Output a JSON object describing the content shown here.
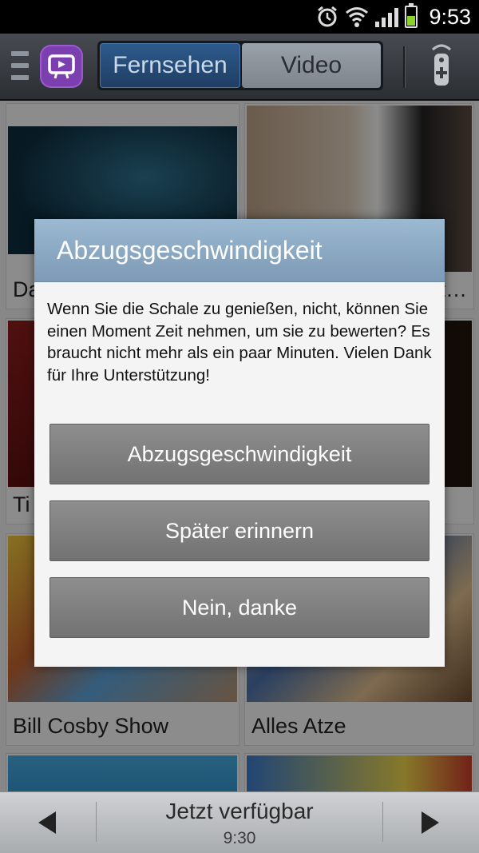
{
  "status_bar": {
    "time": "9:53"
  },
  "header": {
    "tabs": [
      {
        "label": "Fernsehen"
      },
      {
        "label": "Video"
      }
    ]
  },
  "grid": {
    "cards": [
      {
        "title": "Da"
      },
      {
        "title": "…t…"
      },
      {
        "title": "Ti"
      },
      {
        "title": ""
      },
      {
        "title": "Bill Cosby Show"
      },
      {
        "title": "Alles Atze"
      }
    ]
  },
  "dialog": {
    "title": "Abzugsgeschwindigkeit",
    "message": "Wenn Sie die Schale zu genießen, nicht, können Sie einen Moment Zeit nehmen, um sie zu bewerten? Es braucht nicht mehr als ein paar Minuten. Vielen Dank für Ihre Unterstützung!",
    "buttons": [
      {
        "label": "Abzugsgeschwindigkeit"
      },
      {
        "label": "Später erinnern"
      },
      {
        "label": "Nein, danke"
      }
    ]
  },
  "bottom_bar": {
    "label": "Jetzt verfügbar",
    "time": "9:30"
  },
  "colors": {
    "accent_purple": "#7c3fb0",
    "tab_active": "#2d5a8c",
    "dialog_header": "#8faac4"
  }
}
